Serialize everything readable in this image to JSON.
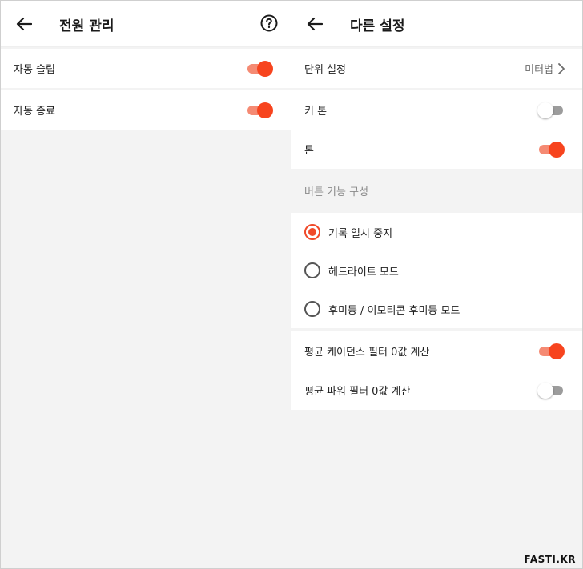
{
  "left": {
    "title": "전원 관리",
    "rows": [
      {
        "label": "자동 슬립",
        "toggle": true
      },
      {
        "label": "자동 종료",
        "toggle": true
      }
    ]
  },
  "right": {
    "title": "다른 설정",
    "unit": {
      "label": "단위 설정",
      "value": "미터법"
    },
    "rows_top": [
      {
        "label": "키 톤",
        "toggle": false
      },
      {
        "label": "톤",
        "toggle": true
      }
    ],
    "section_header": "버튼 기능 구성",
    "radio_options": [
      {
        "label": "기록 일시 중지",
        "selected": true
      },
      {
        "label": "헤드라이트 모드",
        "selected": false
      },
      {
        "label": "후미등 / 이모티콘 후미등 모드",
        "selected": false
      }
    ],
    "rows_bottom": [
      {
        "label": "평균 케이던스 필터 0값 계산",
        "toggle": true
      },
      {
        "label": "평균 파워 필터 0값 계산",
        "toggle": false
      }
    ]
  },
  "watermark": "FASTI.KR",
  "colors": {
    "accent": "#f7441e",
    "accent_track": "#f58a73",
    "off_track": "#9c9c9c"
  }
}
